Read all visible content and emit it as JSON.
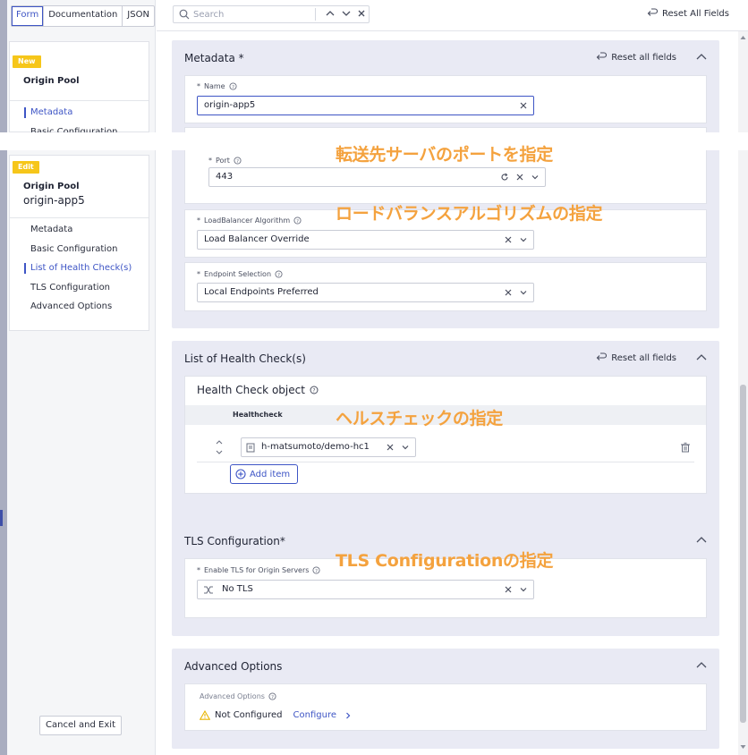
{
  "view_tabs": [
    "Form",
    "Documentation",
    "JSON"
  ],
  "toolbar": {
    "search_placeholder": "Search",
    "reset_all_label": "Reset All Fields"
  },
  "nav": {
    "new_card": {
      "badge": "New",
      "title": "Origin Pool",
      "items": [
        "Metadata",
        "Basic Configuration"
      ]
    },
    "edit_card": {
      "badge": "Edit",
      "title": "Origin Pool",
      "subtitle": "origin-app5",
      "items": [
        "Metadata",
        "Basic Configuration",
        "List of Health Check(s)",
        "TLS Configuration",
        "Advanced Options"
      ]
    },
    "cancel_label": "Cancel and Exit"
  },
  "metadata": {
    "title": "Metadata",
    "required_mark": "*",
    "reset_label": "Reset all fields",
    "name_label": "Name",
    "name_value": "origin-app5",
    "port_label": "Port",
    "port_value": "443",
    "lb_label": "LoadBalancer Algorithm",
    "lb_value": "Load Balancer Override",
    "endpoint_label": "Endpoint Selection",
    "endpoint_value": "Local Endpoints Preferred"
  },
  "health": {
    "title": "List of Health Check(s)",
    "reset_label": "Reset all fields",
    "object_title": "Health Check object",
    "column_header": "Healthcheck",
    "row_value": "h-matsumoto/demo-hc1",
    "add_label": "Add item"
  },
  "tls": {
    "title": "TLS Configuration",
    "required_mark": "*",
    "field_label": "Enable TLS for Origin Servers",
    "field_value": "No TLS"
  },
  "advanced": {
    "title": "Advanced Options",
    "field_label": "Advanced Options",
    "status": "Not Configured",
    "configure_label": "Configure"
  },
  "required_star": "*",
  "annotations": {
    "port": "転送先サーバのポートを指定",
    "lb": "ロードバランスアルゴリズムの指定",
    "health": "ヘルスチェックの指定",
    "tls": "TLS Configurationの指定"
  },
  "colors": {
    "accent": "#3e55c5",
    "badge": "#f6c61a",
    "annotation": "#f4a23e",
    "section_bg": "#e9eaf4",
    "warning": "#e8b400"
  }
}
